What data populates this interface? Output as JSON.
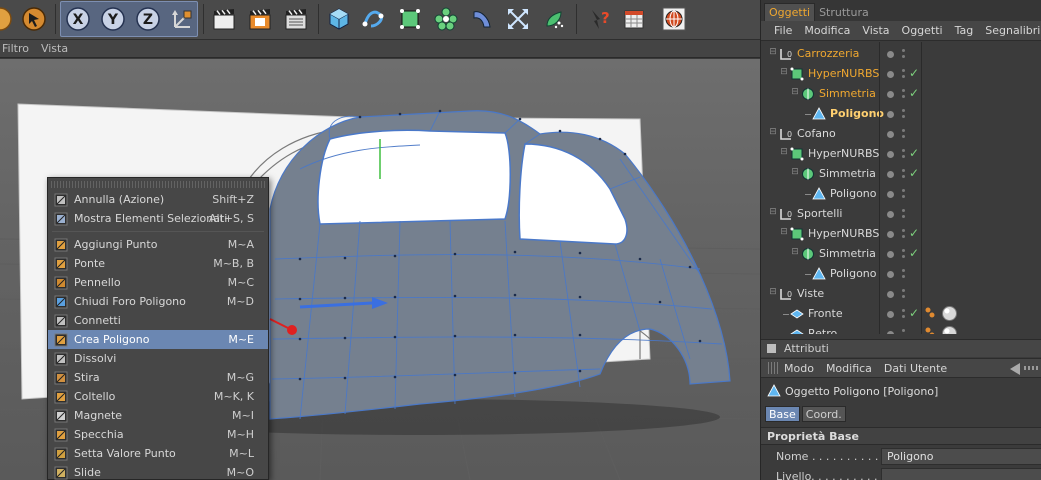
{
  "viewport": {
    "menu": [
      "Filtro",
      "Vista"
    ],
    "nav_icons": [
      "move-icon",
      "zoom-icon",
      "rotate-icon",
      "maximize-icon"
    ]
  },
  "toolbar": {
    "axis_x": "X",
    "axis_y": "Y",
    "axis_z": "Z",
    "icons": [
      "selection-icon",
      "undo-icon",
      "axis-x-icon",
      "axis-y-icon",
      "axis-z-icon",
      "coordinate-system-icon",
      "render-view-icon",
      "render-active-icon",
      "render-settings-icon",
      "cube-icon",
      "spline-icon",
      "nurbs-icon",
      "array-icon",
      "deformer-icon",
      "scene-icon",
      "environment-icon",
      "help-icon",
      "timeline-icon",
      "web-icon"
    ]
  },
  "context_menu": {
    "items": [
      {
        "label": "Annulla (Azione)",
        "shortcut": "Shift+Z",
        "icon": "undo-action-icon"
      },
      {
        "label": "Mostra Elementi Selezionati",
        "shortcut": "Alt+S, S",
        "icon": "frame-selected-icon"
      },
      {
        "sep": true
      },
      {
        "label": "Aggiungi Punto",
        "shortcut": "M~A",
        "icon": "add-point-icon"
      },
      {
        "label": "Ponte",
        "shortcut": "M~B, B",
        "icon": "bridge-icon"
      },
      {
        "label": "Pennello",
        "shortcut": "M~C",
        "icon": "brush-icon"
      },
      {
        "label": "Chiudi Foro Poligono",
        "shortcut": "M~D",
        "icon": "close-hole-icon"
      },
      {
        "label": "Connetti",
        "shortcut": "",
        "icon": "connect-icon"
      },
      {
        "label": "Crea Poligono",
        "shortcut": "M~E",
        "icon": "create-polygon-icon",
        "selected": true
      },
      {
        "label": "Dissolvi",
        "shortcut": "",
        "icon": "dissolve-icon"
      },
      {
        "label": "Stira",
        "shortcut": "M~G",
        "icon": "iron-icon"
      },
      {
        "label": "Coltello",
        "shortcut": "M~K, K",
        "icon": "knife-icon"
      },
      {
        "label": "Magnete",
        "shortcut": "M~I",
        "icon": "magnet-icon"
      },
      {
        "label": "Specchia",
        "shortcut": "M~H",
        "icon": "mirror-icon"
      },
      {
        "label": "Setta Valore Punto",
        "shortcut": "M~L",
        "icon": "set-point-value-icon"
      },
      {
        "label": "Slide",
        "shortcut": "M~O",
        "icon": "slide-icon"
      }
    ]
  },
  "object_manager": {
    "tabs": [
      "Oggetti",
      "Struttura"
    ],
    "menu": [
      "File",
      "Modifica",
      "Vista",
      "Oggetti",
      "Tag",
      "Segnalibri"
    ],
    "rows": [
      {
        "name": "Carrozzeria",
        "type": "null",
        "indent": 0,
        "color": "orange"
      },
      {
        "name": "HyperNURBS",
        "type": "hypernurbs",
        "indent": 1,
        "color": "orange",
        "check": true
      },
      {
        "name": "Simmetria",
        "type": "symmetry",
        "indent": 2,
        "color": "orange",
        "check": true
      },
      {
        "name": "Poligono",
        "type": "polygon",
        "indent": 3,
        "color": "selected"
      },
      {
        "name": "Cofano",
        "type": "null",
        "indent": 0
      },
      {
        "name": "HyperNURBS",
        "type": "hypernurbs",
        "indent": 1,
        "check": true
      },
      {
        "name": "Simmetria",
        "type": "symmetry",
        "indent": 2,
        "check": true
      },
      {
        "name": "Poligono",
        "type": "polygon",
        "indent": 3
      },
      {
        "name": "Sportelli",
        "type": "null",
        "indent": 0
      },
      {
        "name": "HyperNURBS",
        "type": "hypernurbs",
        "indent": 1,
        "check": true
      },
      {
        "name": "Simmetria",
        "type": "symmetry",
        "indent": 2,
        "check": true
      },
      {
        "name": "Poligono",
        "type": "polygon",
        "indent": 3
      },
      {
        "name": "Viste",
        "type": "null",
        "indent": 0
      },
      {
        "name": "Fronte",
        "type": "camera",
        "indent": 1,
        "check": true,
        "tags": true
      },
      {
        "name": "Retro",
        "type": "camera",
        "indent": 1,
        "tags": true
      }
    ]
  },
  "attributes": {
    "title": "Attributi",
    "menu": [
      "Modo",
      "Modifica",
      "Dati Utente"
    ],
    "object_label": "Oggetto Poligono [Poligono]",
    "tabs": [
      "Base",
      "Coord."
    ],
    "section": "Proprietà Base",
    "props": [
      {
        "label": "Nome . . . . . . . . . . . .",
        "value": "Poligono"
      },
      {
        "label": "Livello. . . . . . . . . . .",
        "value": ""
      }
    ]
  },
  "colors": {
    "accent": "#6b87b2",
    "active_tab": "#f0a830",
    "mesh_line": "#4a78c8",
    "check": "#7dd07d"
  }
}
